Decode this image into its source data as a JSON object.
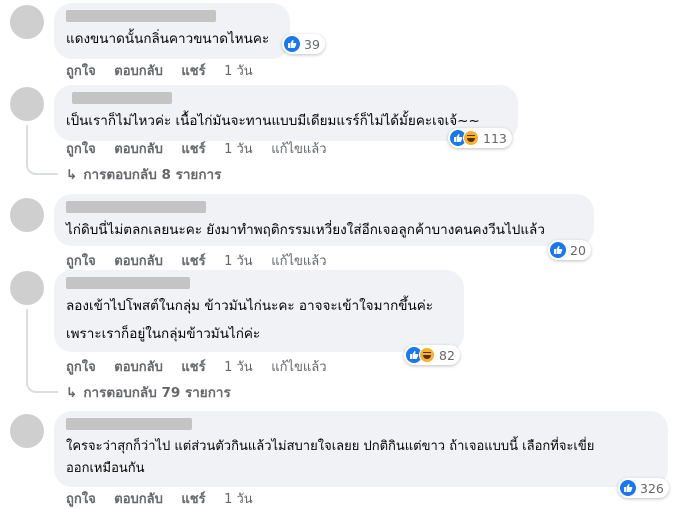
{
  "actions": {
    "like": "ถูกใจ",
    "reply": "ตอบกลับ",
    "share": "แชร์",
    "edited": "แก้ไขแล้ว"
  },
  "comments": [
    {
      "text": "แดงขนาดนั้นกลิ่นคาวขนาดไหนคะ",
      "reactions": "39",
      "time": "1 วัน"
    },
    {
      "text": "เป็นเราก็ไม่ไหวค่ะ เนื้อไก่มันจะทานแบบมีเดียมแรร์ก็ไม่ได้มั้ยคะเจเจ้~~",
      "reactions": "113",
      "time": "1 วัน",
      "replies": "การตอบกลับ 8 รายการ"
    },
    {
      "text": "ไก่ดิบนี่ไม่ตลกเลยนะคะ ยังมาทำพฤติกรรมเหวี่ยงใส่อีกเจอลูกค้าบางคนคงวีนไปแล้ว",
      "reactions": "20",
      "time": "1 วัน"
    },
    {
      "text_line1": "ลองเข้าไปโพสต์ในกลุ่ม ข้าวมันไก่นะคะ อาจจะเข้าใจมากขึ้นค่ะ",
      "text_line2": "เพราะเราก็อยู่ในกลุ่มข้าวมันไก่ค่ะ",
      "reactions": "82",
      "time": "1 วัน",
      "replies": "การตอบกลับ 79 รายการ"
    },
    {
      "text_line1": "ใครจะว่าสุกก็ว่าไป แต่ส่วนตัวกินแล้วไม่สบายใจเลยย ปกติกินแต่ขาว ถ้าเจอแบบนี้ เลือกที่จะเขี่ย",
      "text_line2": "ออกเหมือนกัน",
      "reactions": "326",
      "time": "1 วัน"
    }
  ],
  "colors": {
    "like_blue": "#1877f2",
    "bubble_bg": "#f0f2f5",
    "meta_gray": "#65676b"
  },
  "icons": [
    "like-icon",
    "haha-icon",
    "reply-arrow-icon"
  ]
}
